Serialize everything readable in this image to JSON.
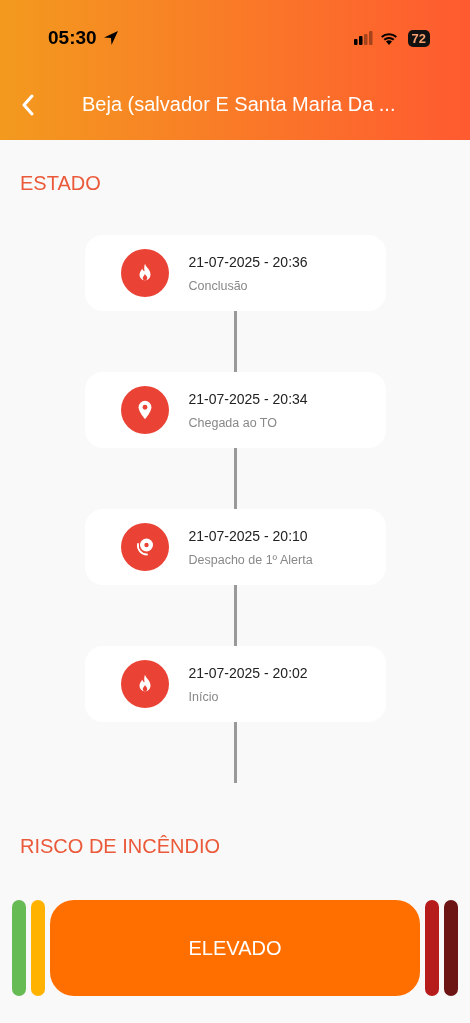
{
  "status_bar": {
    "time": "05:30",
    "battery": "72"
  },
  "nav": {
    "title": "Beja (salvador E Santa Maria Da ..."
  },
  "estado": {
    "heading": "ESTADO",
    "events": [
      {
        "kind": "fire",
        "datetime": "21-07-2025 - 20:36",
        "label": "Conclusão"
      },
      {
        "kind": "location",
        "datetime": "21-07-2025 - 20:34",
        "label": "Chegada ao TO"
      },
      {
        "kind": "alarm",
        "datetime": "21-07-2025 - 20:10",
        "label": "Despacho de 1º Alerta"
      },
      {
        "kind": "fire",
        "datetime": "21-07-2025 - 20:02",
        "label": "Início"
      }
    ]
  },
  "risk": {
    "heading": "RISCO DE INCÊNDIO",
    "levels": [
      {
        "color": "#66bb55",
        "selected": false
      },
      {
        "color": "#ffb300",
        "selected": false
      },
      {
        "color": "#ff6f00",
        "selected": true,
        "label": "ELEVADO"
      },
      {
        "color": "#b71c1c",
        "selected": false
      },
      {
        "color": "#6d1414",
        "selected": false
      }
    ]
  }
}
